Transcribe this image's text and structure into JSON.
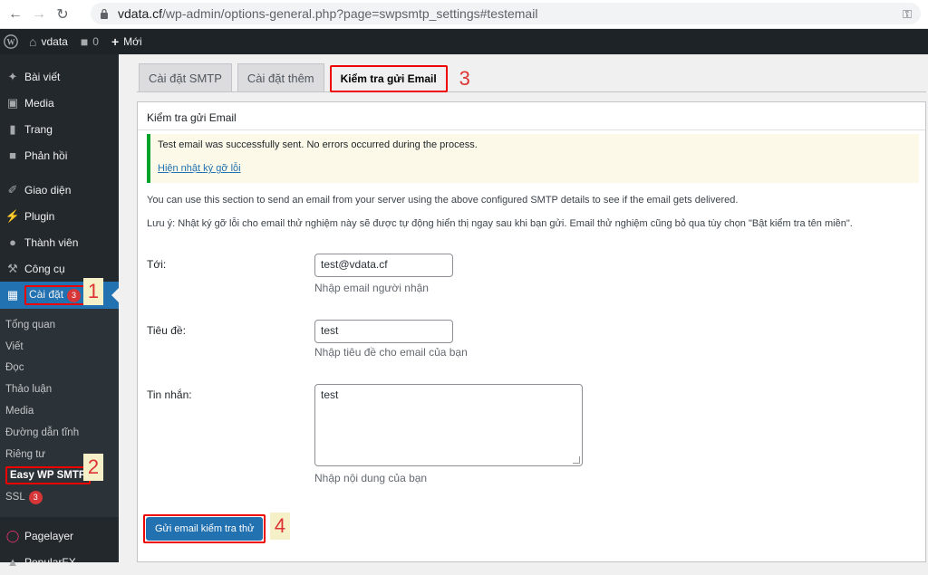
{
  "browser": {
    "url_host": "vdata.cf",
    "url_path": "/wp-admin/options-general.php?page=swpsmtp_settings#testemail"
  },
  "adminbar": {
    "site_name": "vdata",
    "comments_count": "0",
    "new_label": "Mới"
  },
  "sidebar": {
    "items": [
      {
        "label": "Bài viết",
        "icon": "pin-icon"
      },
      {
        "label": "Media",
        "icon": "media-icon"
      },
      {
        "label": "Trang",
        "icon": "page-icon"
      },
      {
        "label": "Phản hồi",
        "icon": "comment-icon"
      },
      {
        "label": "Giao diện",
        "icon": "brush-icon"
      },
      {
        "label": "Plugin",
        "icon": "plugin-icon"
      },
      {
        "label": "Thành viên",
        "icon": "user-icon"
      },
      {
        "label": "Công cụ",
        "icon": "wrench-icon"
      }
    ],
    "current": {
      "label": "Cài đặt",
      "badge": "3"
    },
    "submenu": [
      "Tổng quan",
      "Viết",
      "Đọc",
      "Thảo luận",
      "Media",
      "Đường dẫn tĩnh",
      "Riêng tư",
      "Easy WP SMTP",
      "SSL"
    ],
    "ssl_badge": "3",
    "pagelayer": "Pagelayer",
    "popularfx": "PopularFX",
    "callouts": [
      "1",
      "2"
    ]
  },
  "tabs": [
    "Cài đặt SMTP",
    "Cài đặt thêm",
    "Kiểm tra gửi Email"
  ],
  "tab_callout": "3",
  "panel": {
    "title": "Kiểm tra gửi Email",
    "notice_text": "Test email was successfully sent. No errors occurred during the process.",
    "notice_link": "Hiện nhật ký gỡ lỗi",
    "desc1": "You can use this section to send an email from your server using the above configured SMTP details to see if the email gets delivered.",
    "note_label": "Lưu ý:",
    "note_text": " Nhật ký gỡ lỗi cho email thử nghiệm này sẽ được tự động hiển thị ngay sau khi bạn gửi. Email thử nghiệm cũng bỏ qua tùy chọn \"Bật kiểm tra tên miền\".",
    "to_label": "Tới:",
    "to_value": "test@vdata.cf",
    "to_help": "Nhập email người nhận",
    "subject_label": "Tiêu đề:",
    "subject_value": "test",
    "subject_help": "Nhập tiêu đề cho email của bạn",
    "message_label": "Tin nhắn:",
    "message_value": "test",
    "message_help": "Nhập nội dung của bạn",
    "submit_label": "Gửi email kiểm tra thử",
    "submit_callout": "4"
  }
}
